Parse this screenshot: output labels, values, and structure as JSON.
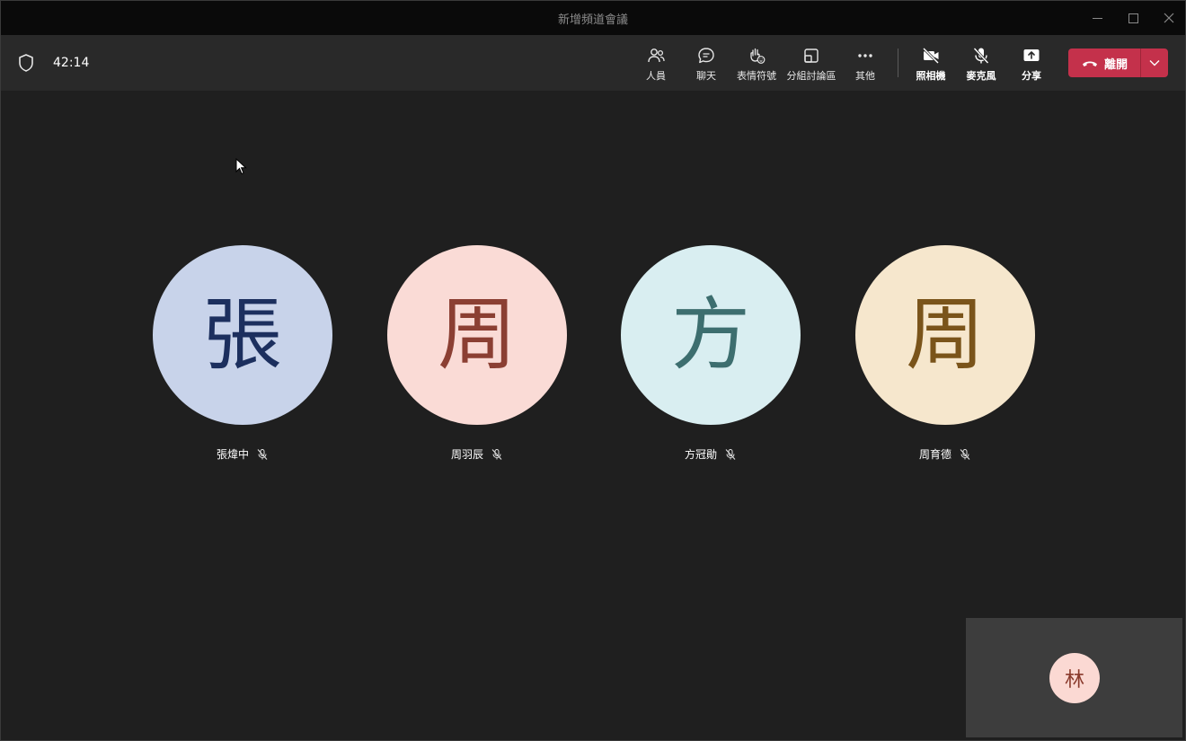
{
  "window": {
    "title": "新增頻道會議"
  },
  "header": {
    "timer": "42:14",
    "toolbar": [
      {
        "key": "people",
        "label": "人員",
        "icon": "people-icon"
      },
      {
        "key": "chat",
        "label": "聊天",
        "icon": "chat-icon"
      },
      {
        "key": "reactions",
        "label": "表情符號",
        "icon": "raise-hand-icon"
      },
      {
        "key": "breakout",
        "label": "分組討論區",
        "icon": "breakout-rooms-icon"
      },
      {
        "key": "more",
        "label": "其他",
        "icon": "more-icon"
      },
      {
        "key": "camera",
        "label": "照相機",
        "icon": "camera-off-icon"
      },
      {
        "key": "mic",
        "label": "麥克風",
        "icon": "mic-off-icon"
      },
      {
        "key": "share",
        "label": "分享",
        "icon": "share-icon"
      }
    ],
    "leave_label": "離開",
    "leave_color": "#c4314b"
  },
  "participants": [
    {
      "name": "張煒中",
      "initial": "張",
      "bg": "#c8d3ea",
      "fg": "#1c2f5e",
      "muted": true
    },
    {
      "name": "周羽辰",
      "initial": "周",
      "bg": "#fadbd6",
      "fg": "#8b3f33",
      "muted": true
    },
    {
      "name": "方冠勛",
      "initial": "方",
      "bg": "#d9eef1",
      "fg": "#3d6e6f",
      "muted": true
    },
    {
      "name": "周育德",
      "initial": "周",
      "bg": "#f6e7cd",
      "fg": "#7a541a",
      "muted": true
    }
  ],
  "self_view": {
    "initial": "林"
  }
}
